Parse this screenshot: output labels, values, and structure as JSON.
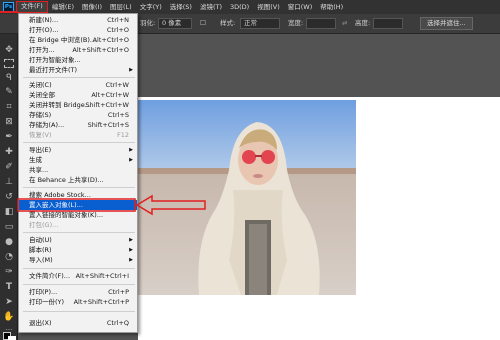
{
  "menubar": {
    "logo": "Ps",
    "items": [
      "文件(F)",
      "编辑(E)",
      "图像(I)",
      "图层(L)",
      "文字(Y)",
      "选择(S)",
      "滤镜(T)",
      "3D(D)",
      "视图(V)",
      "窗口(W)",
      "帮助(H)"
    ],
    "active_index": 0
  },
  "optionsbar": {
    "feather_label": "羽化:",
    "feather_value": "0 像素",
    "style_label": "样式:",
    "style_value": "正常",
    "width_label": "宽度:",
    "height_label": "高度:",
    "select_mask_button": "选择并遮住..."
  },
  "file_menu": {
    "items": [
      {
        "label": "新建(N)...",
        "shortcut": "Ctrl+N"
      },
      {
        "label": "打开(O)...",
        "shortcut": "Ctrl+O"
      },
      {
        "label": "在 Bridge 中浏览(B)...",
        "shortcut": "Alt+Ctrl+O"
      },
      {
        "label": "打开为...",
        "shortcut": "Alt+Shift+Ctrl+O"
      },
      {
        "label": "打开为智能对象...",
        "shortcut": ""
      },
      {
        "label": "最近打开文件(T)",
        "shortcut": "",
        "submenu": true
      },
      {
        "label": "关闭(C)",
        "shortcut": "Ctrl+W"
      },
      {
        "label": "关闭全部",
        "shortcut": "Alt+Ctrl+W"
      },
      {
        "label": "关闭并转到 Bridge...",
        "shortcut": "Shift+Ctrl+W"
      },
      {
        "label": "存储(S)",
        "shortcut": "Ctrl+S"
      },
      {
        "label": "存储为(A)...",
        "shortcut": "Shift+Ctrl+S"
      },
      {
        "label": "恢复(V)",
        "shortcut": "F12",
        "disabled": true
      },
      {
        "label": "导出(E)",
        "shortcut": "",
        "submenu": true
      },
      {
        "label": "生成",
        "shortcut": "",
        "submenu": true
      },
      {
        "label": "共享...",
        "shortcut": ""
      },
      {
        "label": "在 Behance 上共享(D)...",
        "shortcut": ""
      },
      {
        "label": "搜索 Adobe Stock...",
        "shortcut": ""
      },
      {
        "label": "置入嵌入对象(L)...",
        "shortcut": "",
        "highlight": true
      },
      {
        "label": "置入链接的智能对象(K)...",
        "shortcut": ""
      },
      {
        "label": "打包(G)...",
        "shortcut": "",
        "disabled": true
      },
      {
        "label": "自动(U)",
        "shortcut": "",
        "submenu": true
      },
      {
        "label": "脚本(R)",
        "shortcut": "",
        "submenu": true
      },
      {
        "label": "导入(M)",
        "shortcut": "",
        "submenu": true
      },
      {
        "label": "文件简介(F)...",
        "shortcut": "Alt+Shift+Ctrl+I"
      },
      {
        "label": "打印(P)...",
        "shortcut": "Ctrl+P"
      },
      {
        "label": "打印一份(Y)",
        "shortcut": "Alt+Shift+Ctrl+P"
      },
      {
        "label": "退出(X)",
        "shortcut": "Ctrl+Q"
      }
    ]
  },
  "colors": {
    "highlight": "#0a5fd0",
    "annotation_red": "#e02020"
  }
}
